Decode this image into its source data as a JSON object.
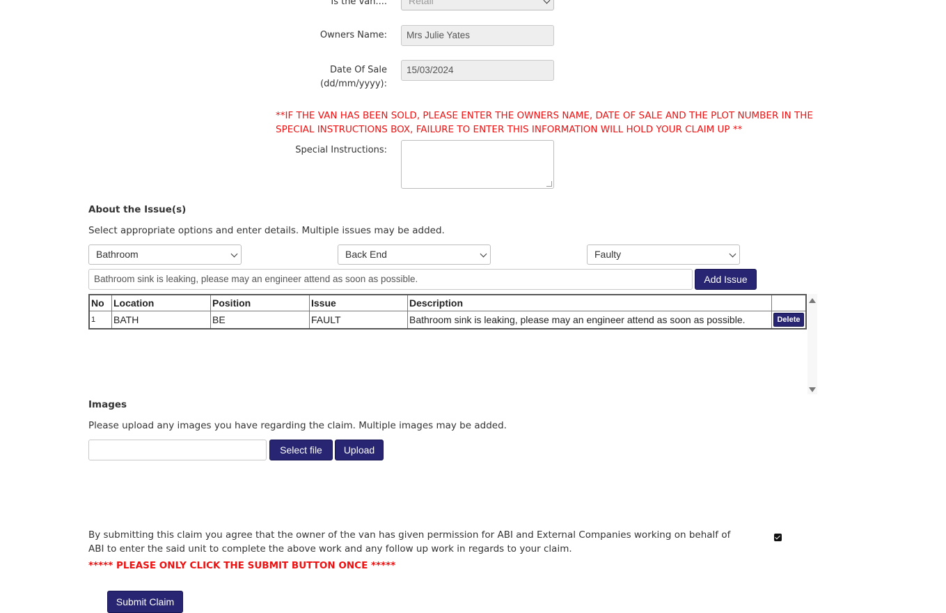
{
  "van": {
    "type_label": "Is the van....",
    "type_value": "Retail",
    "owner_label": "Owners Name:",
    "owner_value": "Mrs Julie Yates",
    "sale_date_label": "Date Of Sale",
    "sale_date_format": "(dd/mm/yyyy):",
    "sale_date_value": "15/03/2024"
  },
  "notice": "**IF THE VAN HAS BEEN SOLD, PLEASE ENTER THE OWNERS NAME, DATE OF SALE AND THE PLOT NUMBER IN THE SPECIAL INSTRUCTIONS BOX, FAILURE TO ENTER THIS INFORMATION WILL HOLD YOUR CLAIM UP **",
  "special": {
    "label": "Special Instructions:",
    "value": ""
  },
  "issues": {
    "heading": "About the Issue(s)",
    "instructions": "Select appropriate options and enter details. Multiple issues may be added.",
    "location_select": "Bathroom",
    "position_select": "Back End",
    "issue_select": "Faulty",
    "description_value": "Bathroom sink is leaking, please may an engineer attend as soon as possible.",
    "add_button": "Add Issue",
    "columns": [
      "No",
      "Location",
      "Position",
      "Issue",
      "Description",
      ""
    ],
    "rows": [
      {
        "no": "1",
        "location": "BATH",
        "position": "BE",
        "issue": "FAULT",
        "description": "Bathroom sink is leaking, please may an engineer attend as soon as possible.",
        "delete_label": "Delete"
      }
    ]
  },
  "images": {
    "heading": "Images",
    "instructions": "Please upload any images you have regarding the claim. Multiple images may be added.",
    "file_value": "",
    "select_button": "Select file",
    "upload_button": "Upload"
  },
  "agreement": {
    "text": "By submitting this claim you agree that the owner of the van has given permission for ABI and External Companies working on behalf of ABI to enter the said unit to complete the above work and any follow up work in regards to your claim.",
    "checked": true,
    "warning": "***** PLEASE ONLY CLICK THE SUBMIT BUTTON ONCE *****",
    "submit_button": "Submit Claim"
  },
  "colors": {
    "button_bg": "#282672",
    "warning_red": "#ee1111"
  },
  "icons": [
    "chevron-down-icon",
    "scroll-up-icon",
    "scroll-down-icon",
    "checkbox-checked-icon"
  ]
}
